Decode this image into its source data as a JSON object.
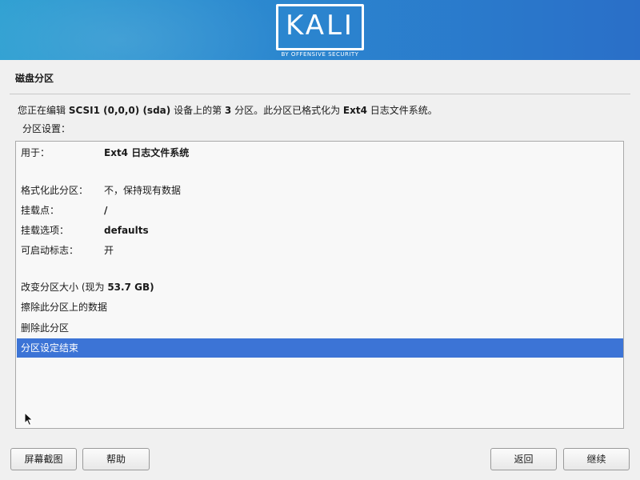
{
  "header": {
    "logo_text": "KALI",
    "logo_subtitle": "BY OFFENSIVE SECURITY",
    "gradient_colors": [
      "#2fa0d2",
      "#2a6fc8"
    ]
  },
  "page": {
    "title": "磁盘分区",
    "description": {
      "p1": "您正在编辑 ",
      "device": "SCSI1 (0,0,0) (sda)",
      "p2": " 设备上的第 ",
      "number": "3",
      "p3": " 分区。此分区已格式化为 ",
      "fs": "Ext4",
      "p4": " 日志文件系统。"
    },
    "settings_label": "分区设置："
  },
  "settings": [
    {
      "key": "用于：",
      "value": "Ext4 日志文件系统"
    },
    {
      "key": "格式化此分区：",
      "value": "不，保持现有数据"
    },
    {
      "key": "挂载点：",
      "value": "/"
    },
    {
      "key": "挂载选项：",
      "value": "defaults"
    },
    {
      "key": "可启动标志：",
      "value": "开"
    }
  ],
  "actions": {
    "resize_prefix": "改变分区大小 (现为 ",
    "resize_size": "53.7 GB",
    "resize_suffix": ")",
    "erase": "擦除此分区上的数据",
    "delete": "删除此分区",
    "done": "分区设定结束"
  },
  "buttons": {
    "screenshot": "屏幕截图",
    "help": "帮助",
    "back": "返回",
    "continue": "继续"
  },
  "colors": {
    "selection": "#3c74d6"
  }
}
